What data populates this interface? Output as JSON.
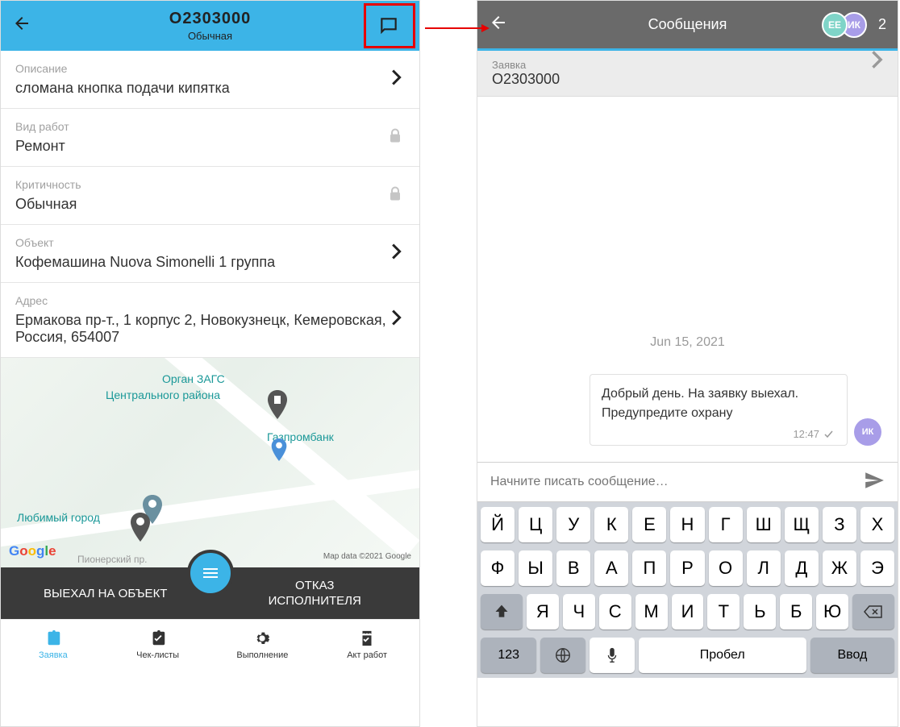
{
  "left": {
    "header": {
      "title": "O2303000",
      "subtitle": "Обычная"
    },
    "rows": [
      {
        "label": "Описание",
        "value": "сломана кнопка подачи кипятка",
        "icon": "chevron"
      },
      {
        "label": "Вид работ",
        "value": "Ремонт",
        "icon": "lock"
      },
      {
        "label": "Критичность",
        "value": "Обычная",
        "icon": "lock"
      },
      {
        "label": "Объект",
        "value": "Кофемашина Nuova Simonelli 1 группа",
        "icon": "chevron"
      },
      {
        "label": "Адрес",
        "value": "Ермакова пр-т., 1 корпус 2, Новокузнецк, Кемеровская, Россия, 654007",
        "icon": "chevron"
      }
    ],
    "map": {
      "poi1": "Орган ЗАГС",
      "poi1b": "Центрального района",
      "poi2": "Газпромбанк",
      "poi3": "Любимый город",
      "street": "Пионерский пр.",
      "attribution": "Map data ©2021 Google"
    },
    "actions": {
      "left": "ВЫЕХАЛ НА ОБЪЕКТ",
      "right_l1": "ОТКАЗ",
      "right_l2": "ИСПОЛНИТЕЛЯ"
    },
    "nav": [
      {
        "label": "Заявка"
      },
      {
        "label": "Чек-листы"
      },
      {
        "label": "Выполнение"
      },
      {
        "label": "Акт работ"
      }
    ]
  },
  "right": {
    "header": {
      "title": "Сообщения",
      "av1": "EE",
      "av2": "ИК",
      "count": "2"
    },
    "request": {
      "label": "Заявка",
      "id": "O2303000"
    },
    "chat": {
      "date": "Jun 15, 2021",
      "msg_text": "Добрый день. На заявку выехал. Предупредите охрану",
      "msg_time": "12:47",
      "msg_avatar": "ИК"
    },
    "composer": {
      "placeholder": "Начните писать сообщение…"
    },
    "keyboard": {
      "row1": [
        "Й",
        "Ц",
        "У",
        "К",
        "Е",
        "Н",
        "Г",
        "Ш",
        "Щ",
        "З",
        "Х"
      ],
      "row2": [
        "Ф",
        "Ы",
        "В",
        "А",
        "П",
        "Р",
        "О",
        "Л",
        "Д",
        "Ж",
        "Э"
      ],
      "row3": [
        "Я",
        "Ч",
        "С",
        "М",
        "И",
        "Т",
        "Ь",
        "Б",
        "Ю"
      ],
      "mode": "123",
      "space": "Пробел",
      "enter": "Ввод"
    }
  }
}
